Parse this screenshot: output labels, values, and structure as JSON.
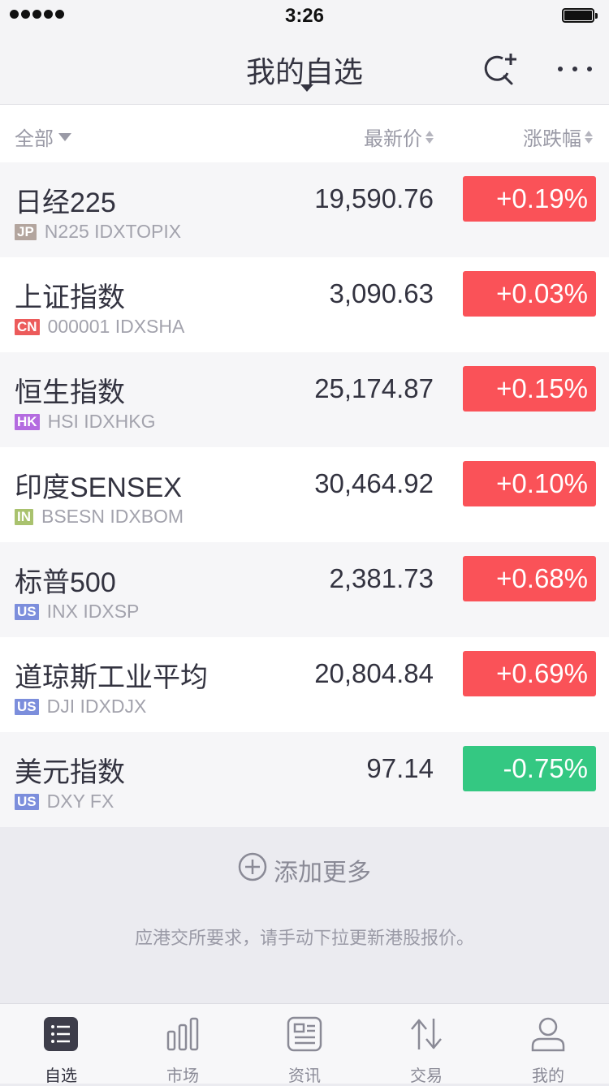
{
  "status_bar": {
    "time": "3:26"
  },
  "nav": {
    "title": "我的自选"
  },
  "header": {
    "all": "全部",
    "price": "最新价",
    "change": "涨跌幅"
  },
  "colors": {
    "up": "#fa5258",
    "down": "#34c882",
    "accent": "#3d3d4a"
  },
  "rows": [
    {
      "name": "日经225",
      "market": "JP",
      "market_color": "#b3a59e",
      "code": "N225 IDXTOPIX",
      "price": "19,590.76",
      "change": "+0.19%",
      "dir": "up"
    },
    {
      "name": "上证指数",
      "market": "CN",
      "market_color": "#ec5b5b",
      "code": "000001 IDXSHA",
      "price": "3,090.63",
      "change": "+0.03%",
      "dir": "up"
    },
    {
      "name": "恒生指数",
      "market": "HK",
      "market_color": "#b46be0",
      "code": "HSI IDXHKG",
      "price": "25,174.87",
      "change": "+0.15%",
      "dir": "up"
    },
    {
      "name": "印度SENSEX",
      "market": "IN",
      "market_color": "#a9c26e",
      "code": "BSESN IDXBOM",
      "price": "30,464.92",
      "change": "+0.10%",
      "dir": "up"
    },
    {
      "name": "标普500",
      "market": "US",
      "market_color": "#7c8edc",
      "code": "INX IDXSP",
      "price": "2,381.73",
      "change": "+0.68%",
      "dir": "up"
    },
    {
      "name": "道琼斯工业平均",
      "market": "US",
      "market_color": "#7c8edc",
      "code": "DJI IDXDJX",
      "price": "20,804.84",
      "change": "+0.69%",
      "dir": "up"
    },
    {
      "name": "美元指数",
      "market": "US",
      "market_color": "#7c8edc",
      "code": "DXY FX",
      "price": "97.14",
      "change": "-0.75%",
      "dir": "down"
    }
  ],
  "add_more": "添加更多",
  "notice": "应港交所要求，请手动下拉更新港股报价。",
  "tabs": [
    {
      "label": "自选",
      "icon": "watchlist-icon",
      "active": true
    },
    {
      "label": "市场",
      "icon": "bar-chart-icon",
      "active": false
    },
    {
      "label": "资讯",
      "icon": "news-icon",
      "active": false
    },
    {
      "label": "交易",
      "icon": "trade-arrows-icon",
      "active": false
    },
    {
      "label": "我的",
      "icon": "person-icon",
      "active": false
    }
  ]
}
